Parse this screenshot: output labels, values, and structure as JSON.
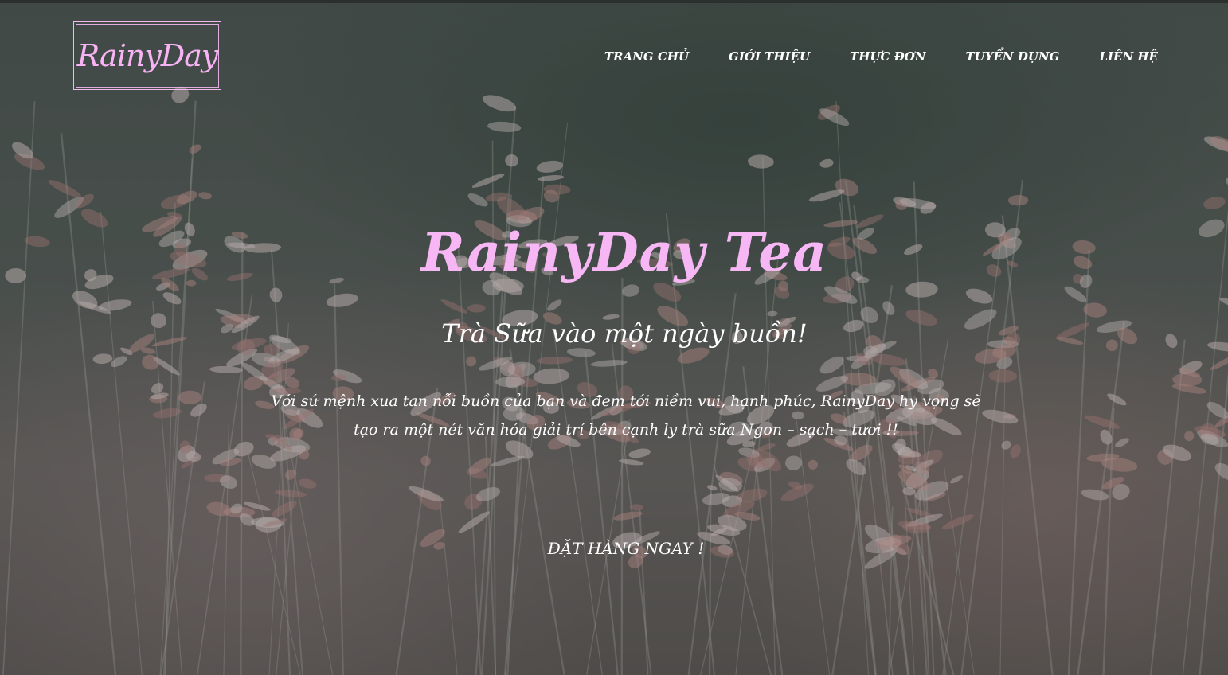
{
  "brand": {
    "logo": "RainyDay"
  },
  "nav": {
    "items": [
      {
        "label": "TRANG CHỦ"
      },
      {
        "label": "GIỚI THIỆU"
      },
      {
        "label": "THỰC ĐƠN"
      },
      {
        "label": "TUYỂN DỤNG"
      },
      {
        "label": "LIÊN HỆ"
      }
    ]
  },
  "hero": {
    "title": "RainyDay Tea",
    "subtitle": "Trà Sữa vào một ngày buồn!",
    "description": "Với sứ mệnh xua tan nỗi buồn của bạn và đem tới niềm vui, hạnh phúc, RainyDay hy vọng sẽ tạo ra một nét văn hóa giải trí bên cạnh ly trà sữa Ngon – sạch – tươi !!",
    "cta_label": "ĐẶT HÀNG NGAY !"
  },
  "colors": {
    "accent_pink": "#f7b6f4",
    "text_white": "#ffffff",
    "bg_dark_green": "#4a5451"
  }
}
